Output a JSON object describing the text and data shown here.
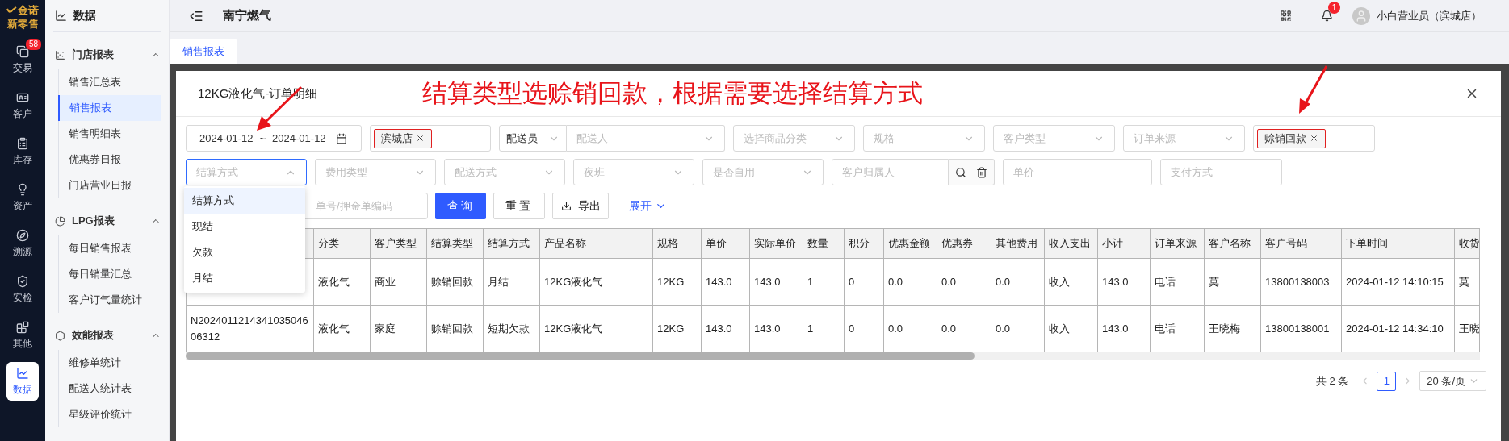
{
  "rail": {
    "brand": "金诺",
    "subtitle": "新零售",
    "items": [
      {
        "label": "交易",
        "badge": "58",
        "selected": false
      },
      {
        "label": "客户",
        "selected": false
      },
      {
        "label": "库存",
        "selected": false
      },
      {
        "label": "资产",
        "selected": false
      },
      {
        "label": "溯源",
        "selected": false
      },
      {
        "label": "安检",
        "selected": false
      },
      {
        "label": "其他",
        "selected": false
      },
      {
        "label": "数据",
        "selected": true
      }
    ]
  },
  "submenu": {
    "title": "数据",
    "groups": [
      {
        "label": "门店报表",
        "expanded": true,
        "items": [
          {
            "label": "销售汇总表",
            "selected": false
          },
          {
            "label": "销售报表",
            "selected": true
          },
          {
            "label": "销售明细表",
            "selected": false
          },
          {
            "label": "优惠券日报",
            "selected": false
          },
          {
            "label": "门店营业日报",
            "selected": false
          }
        ]
      },
      {
        "label": "LPG报表",
        "expanded": true,
        "items": [
          {
            "label": "每日销售报表",
            "selected": false
          },
          {
            "label": "每日销量汇总",
            "selected": false
          },
          {
            "label": "客户订气量统计",
            "selected": false
          }
        ]
      },
      {
        "label": "效能报表",
        "expanded": true,
        "items": [
          {
            "label": "维修单统计",
            "selected": false
          },
          {
            "label": "配送人统计表",
            "selected": false
          },
          {
            "label": "星级评价统计",
            "selected": false
          }
        ]
      }
    ]
  },
  "header": {
    "title": "南宁燃气",
    "notification_badge": "1",
    "user": "小白营业员（滨城店）"
  },
  "tabs": [
    {
      "label": "销售报表",
      "selected": true
    }
  ],
  "modal": {
    "title": "12KG液化气-订单明细",
    "annotation": "结算类型选赊销回款，根据需要选择结算方式",
    "filters_row_1": [
      {
        "kind": "daterange",
        "start": "2024-01-12",
        "separator": "~",
        "end": "2024-01-12"
      },
      {
        "kind": "tags",
        "tags": [
          "滨城店"
        ]
      },
      {
        "kind": "pair",
        "value": "配送员",
        "placeholder": "配送人"
      },
      {
        "kind": "select",
        "placeholder": "选择商品分类",
        "focused": false
      },
      {
        "kind": "select",
        "placeholder": "规格",
        "focused": false
      },
      {
        "kind": "select",
        "placeholder": "客户类型",
        "focused": false
      },
      {
        "kind": "select",
        "placeholder": "订单来源",
        "focused": false
      },
      {
        "kind": "tags",
        "tags": [
          "赊销回款"
        ]
      }
    ],
    "filters_row_2": [
      {
        "kind": "select",
        "placeholder": "结算方式",
        "focused": true
      },
      {
        "kind": "select",
        "placeholder": "费用类型",
        "focused": false
      },
      {
        "kind": "select",
        "placeholder": "配送方式",
        "focused": false
      },
      {
        "kind": "select",
        "placeholder": "夜班",
        "focused": false
      },
      {
        "kind": "select",
        "placeholder": "是否自用",
        "focused": false
      },
      {
        "kind": "search",
        "placeholder": "客户归属人"
      },
      {
        "kind": "input",
        "placeholder": "单价"
      },
      {
        "kind": "input",
        "placeholder": "支付方式"
      }
    ],
    "order_search": {
      "placeholder": "单号/押金单编码"
    },
    "buttons": [
      {
        "label": "查询",
        "kind": "primary"
      },
      {
        "label": "重置",
        "kind": "plain"
      },
      {
        "label": "导出",
        "kind": "export"
      }
    ],
    "expand_link": "展开",
    "dropdown": {
      "options": [
        {
          "label": "结算方式",
          "selected": true
        },
        {
          "label": "现结",
          "selected": false
        },
        {
          "label": "欠款",
          "selected": false
        },
        {
          "label": "月结",
          "selected": false
        }
      ]
    },
    "table": {
      "columns": [
        {},
        {
          "label": "分类"
        },
        {
          "label": "客户类型"
        },
        {
          "label": "结算类型"
        },
        {
          "label": "结算方式"
        },
        {
          "label": "产品名称"
        },
        {
          "label": "规格"
        },
        {
          "label": "单价"
        },
        {
          "label": "实际单价"
        },
        {
          "label": "数量"
        },
        {
          "label": "积分"
        },
        {
          "label": "优惠金额"
        },
        {
          "label": "优惠券"
        },
        {
          "label": "其他费用"
        },
        {
          "label": "收入支出"
        },
        {
          "label": "小计"
        },
        {
          "label": "订单来源"
        },
        {
          "label": "客户名称"
        },
        {
          "label": "客户号码"
        },
        {
          "label": "下单时间"
        },
        {
          "label": "收货"
        }
      ],
      "rows": [
        {
          "cells": [
            null,
            "液化气",
            "商业",
            "赊销回款",
            "月结",
            "12KG液化气",
            "12KG",
            "143.0",
            "143.0",
            "1",
            "0",
            "0.0",
            "0.0",
            "0.0",
            "收入",
            "143.0",
            "电话",
            "莫",
            "13800138003",
            "2024-01-12 14:10:15",
            "莫"
          ]
        },
        {
          "cells": [
            "N202401121434103504606312",
            "液化气",
            "家庭",
            "赊销回款",
            "短期欠款",
            "12KG液化气",
            "12KG",
            "143.0",
            "143.0",
            "1",
            "0",
            "0.0",
            "0.0",
            "0.0",
            "收入",
            "143.0",
            "电话",
            "王晓梅",
            "13800138001",
            "2024-01-12 14:34:10",
            "王晓"
          ]
        }
      ]
    },
    "pagination": {
      "total": "共 2 条",
      "pages": [
        {
          "label": "1",
          "selected": true
        }
      ],
      "page_size": "20 条/页"
    }
  }
}
